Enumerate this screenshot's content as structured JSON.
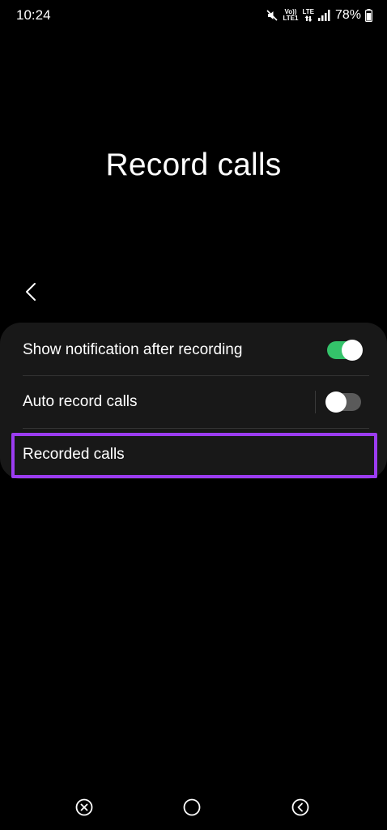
{
  "status_bar": {
    "time": "10:24",
    "net_top": "Vo))",
    "net_bottom": "LTE1",
    "lte_label": "LTE",
    "battery_percent": "78%"
  },
  "page": {
    "title": "Record calls"
  },
  "settings": {
    "rows": [
      {
        "label": "Show notification after recording",
        "toggle": "on"
      },
      {
        "label": "Auto record calls",
        "toggle": "off"
      },
      {
        "label": "Recorded calls"
      }
    ]
  },
  "colors": {
    "background": "#000000",
    "card": "#181818",
    "toggle_on": "#34c26a",
    "toggle_off": "#5a5a5a",
    "highlight": "#9b3cf0"
  },
  "icons": {
    "back": "chevron-left-icon",
    "mute": "mute-icon",
    "signal": "signal-icon",
    "battery": "battery-icon",
    "recents": "recents-icon",
    "home": "home-icon",
    "nav_back": "nav-back-icon"
  }
}
